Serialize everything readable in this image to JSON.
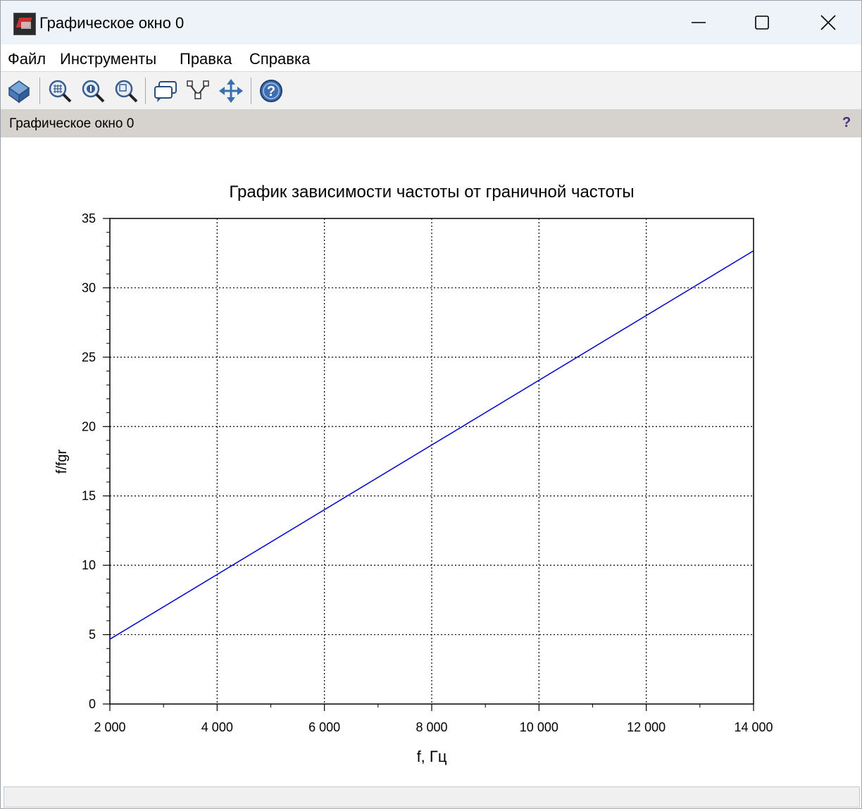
{
  "window": {
    "title": "Графическое окно 0"
  },
  "menu": [
    "Файл",
    "Инструменты",
    "Правка",
    "Справка"
  ],
  "toolbar": {
    "icons": [
      "rotate-icon",
      "zoom-in-icon",
      "zoom-original-icon",
      "zoom-area-icon",
      "datatip-icon",
      "datatip-edit-icon",
      "pan-icon",
      "help-icon"
    ]
  },
  "header": {
    "title": "Графическое окно 0",
    "help": "?"
  },
  "chart_data": {
    "type": "line",
    "title": "График зависимости частоты от граничной частоты",
    "xlabel": "f, Гц",
    "ylabel": "f/fgr",
    "xlim": [
      2000,
      14000
    ],
    "ylim": [
      0,
      35
    ],
    "x_ticks": [
      2000,
      4000,
      6000,
      8000,
      10000,
      12000,
      14000
    ],
    "x_tick_labels": [
      "2 000",
      "4 000",
      "6 000",
      "8 000",
      "10 000",
      "12 000",
      "14 000"
    ],
    "y_ticks": [
      0,
      5,
      10,
      15,
      20,
      25,
      30,
      35
    ],
    "y_tick_labels": [
      "0",
      "5",
      "10",
      "15",
      "20",
      "25",
      "30",
      "35"
    ],
    "grid": true,
    "series": [
      {
        "color": "#0000cc",
        "x": [
          2000,
          14000
        ],
        "values": [
          4.67,
          32.67
        ]
      }
    ]
  }
}
